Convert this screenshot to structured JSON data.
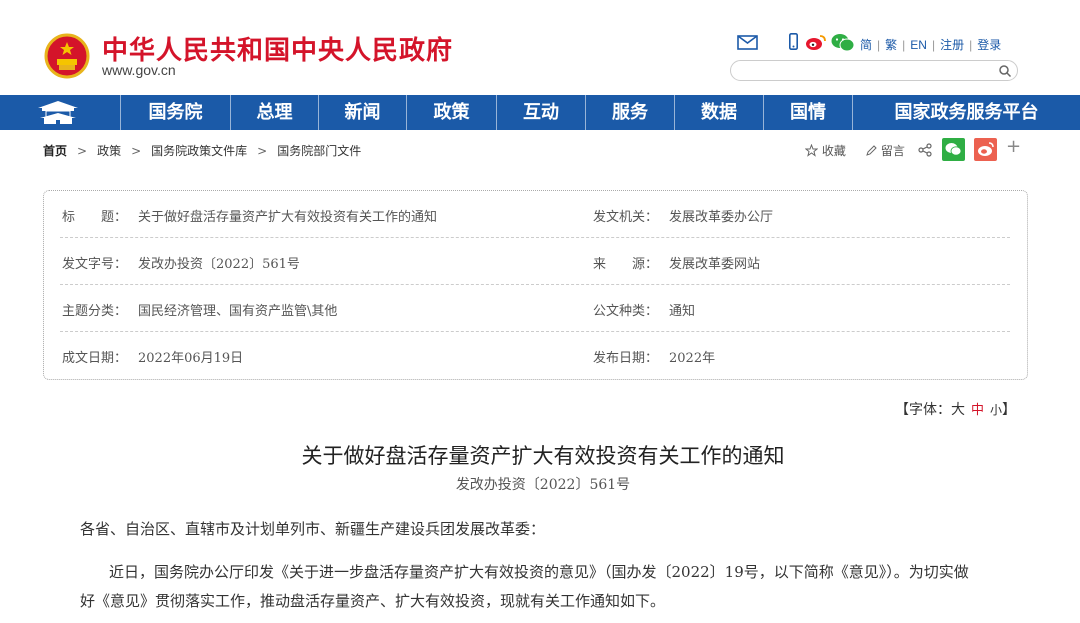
{
  "header": {
    "site_title": "中华人民共和国中央人民政府",
    "site_url": "www.gov.cn",
    "util_links": [
      "简",
      "繁",
      "EN",
      "注册",
      "登录"
    ],
    "search_placeholder": ""
  },
  "nav": {
    "items": [
      "国务院",
      "总理",
      "新闻",
      "政策",
      "互动",
      "服务",
      "数据",
      "国情",
      "国家政务服务平台"
    ]
  },
  "breadcrumb": [
    "首页",
    "政策",
    "国务院政策文件库",
    "国务院部门文件"
  ],
  "share": {
    "favorite": "收藏",
    "comment": "留言",
    "plus": "+"
  },
  "info": {
    "title_label": "标　　题：",
    "title_value": "关于做好盘活存量资产扩大有效投资有关工作的通知",
    "issuer_label": "发文机关：",
    "issuer_value": "发展改革委办公厅",
    "docno_label": "发文字号：",
    "docno_value": "发改办投资〔2022〕561号",
    "source_label": "来　　源：",
    "source_value": "发展改革委网站",
    "topic_label": "主题分类：",
    "topic_value": "国民经济管理、国有资产监管\\其他",
    "type_label": "公文种类：",
    "type_value": "通知",
    "written_label": "成文日期：",
    "written_value": "2022年06月19日",
    "published_label": "发布日期：",
    "published_value": "2022年"
  },
  "fontsize": {
    "open": "【字体：",
    "big": "大",
    "mid": "中",
    "small": "小",
    "close": "】"
  },
  "article": {
    "title": "关于做好盘活存量资产扩大有效投资有关工作的通知",
    "docnum": "发改办投资〔2022〕561号",
    "salutation": "各省、自治区、直辖市及计划单列市、新疆生产建设兵团发展改革委：",
    "para1_line1": "近日，国务院办公厅印发《关于进一步盘活存量资产扩大有效投资的意见》（国办发〔2022〕19号，以下简称《意见》）。为切实做",
    "para1_line2": "好《意见》贯彻落实工作，推动盘活存量资产、扩大有效投资，现就有关工作通知如下。"
  },
  "colors": {
    "brand_red": "#d4142a",
    "nav_blue": "#1b5aa8",
    "wechat_green": "#2fae44",
    "weibo_red": "#ec6150"
  },
  "icons": [
    "national-emblem-icon",
    "mail-icon",
    "mobile-icon",
    "weibo-icon",
    "wechat-icon",
    "search-icon",
    "tiananmen-home-icon",
    "chevron-right-icon",
    "star-icon",
    "pencil-icon",
    "share-icon"
  ]
}
